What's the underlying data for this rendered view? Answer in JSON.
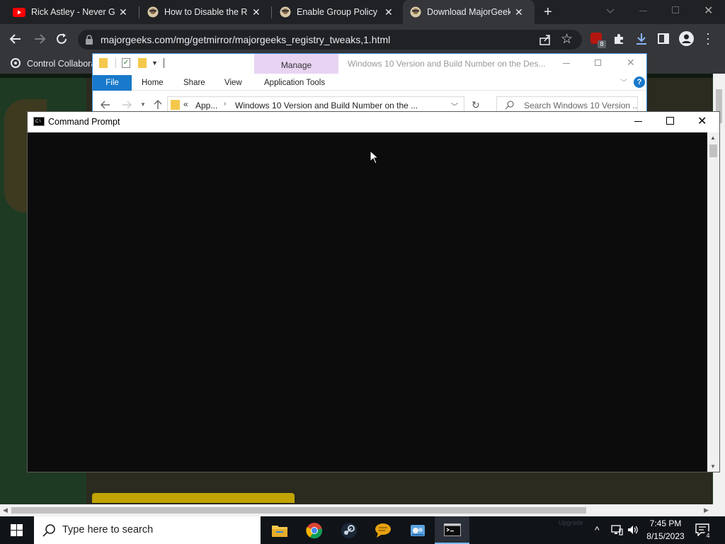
{
  "browser": {
    "tabs": [
      {
        "title": "Rick Astley - Never Gonna Give You Up",
        "active": false,
        "icon": "youtube-icon"
      },
      {
        "title": "How to Disable the Registry Editor",
        "active": false,
        "icon": "majorgeeks-icon"
      },
      {
        "title": "Enable Group Policy Editor",
        "active": false,
        "icon": "majorgeeks-icon"
      },
      {
        "title": "Download MajorGeeks Registry Tweaks",
        "active": true,
        "icon": "majorgeeks-icon"
      }
    ],
    "url": "majorgeeks.com/mg/getmirror/majorgeeks_registry_tweaks,1.html",
    "extension_badge": "8",
    "bookmarks": [
      {
        "label": "Control Collaborat"
      }
    ]
  },
  "explorer": {
    "title": "Windows 10 Version and Build Number on the Des...",
    "context_tab": "Manage",
    "ribbon_tabs": [
      "File",
      "Home",
      "Share",
      "View",
      "Application Tools"
    ],
    "breadcrumb": [
      "App...",
      "Windows 10 Version and Build Number on the ..."
    ],
    "breadcrumb_prefix": "«",
    "search_placeholder": "Search Windows 10 Version ..."
  },
  "cmd": {
    "title": "Command Prompt"
  },
  "taskbar": {
    "search_placeholder": "Type here to search",
    "apps": [
      "file-explorer-icon",
      "chrome-icon",
      "steam-icon",
      "chat-icon",
      "control-panel-icon",
      "command-prompt-icon"
    ],
    "time": "7:45 PM",
    "date": "8/15/2023",
    "notification_count": "4",
    "watermark": "Upgrade"
  },
  "colors": {
    "chrome_dark": "#202124",
    "chrome_toolbar": "#35363a",
    "explorer_accent": "#1979ca",
    "manage_tab": "#e8d4f2",
    "cmd_bg": "#0c0c0c",
    "taskbar": "#101318",
    "download_blue": "#8ab4f8"
  }
}
